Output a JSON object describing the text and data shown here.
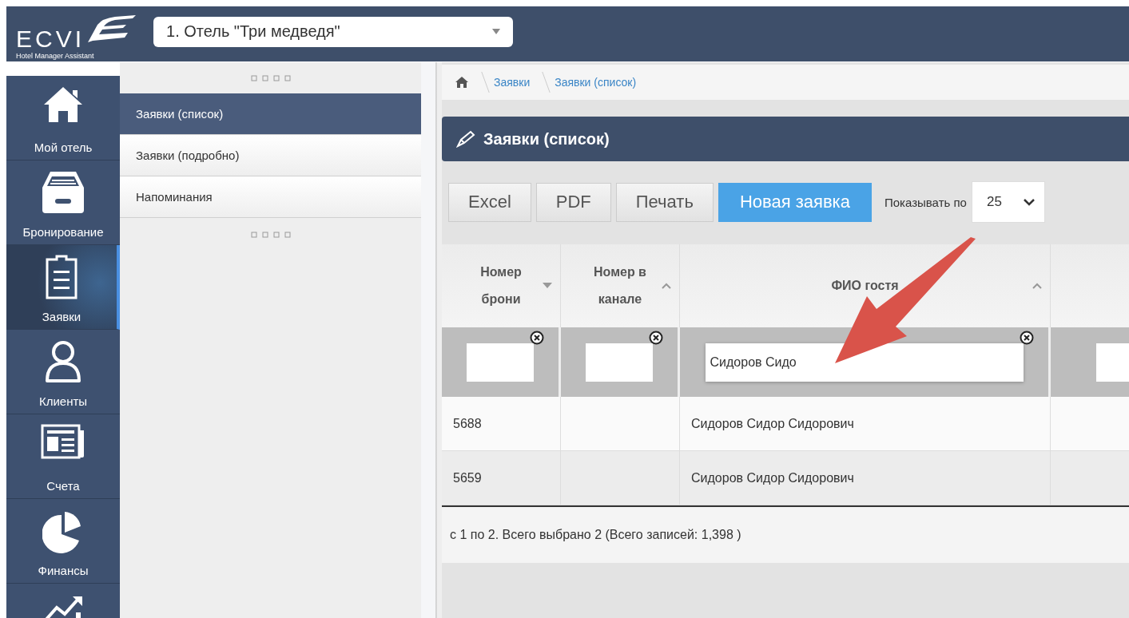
{
  "header": {
    "logo": {
      "wordmark": "ECVI",
      "tagline": "Hotel Manager Assistant"
    },
    "hotel_select": {
      "value": "1. Отель \"Три медведя\""
    }
  },
  "sidebar": {
    "items": [
      {
        "label": "Мой отель",
        "selected": false
      },
      {
        "label": "Бронирование",
        "selected": false
      },
      {
        "label": "Заявки",
        "selected": true
      },
      {
        "label": "Клиенты",
        "selected": false
      },
      {
        "label": "Счета",
        "selected": false
      },
      {
        "label": "Финансы",
        "selected": false
      },
      {
        "selected": false
      }
    ]
  },
  "submenu": {
    "items": [
      {
        "label": "Заявки (список)",
        "selected": true
      },
      {
        "label": "Заявки (подробно)",
        "selected": false
      },
      {
        "label": "Напоминания",
        "selected": false
      }
    ]
  },
  "breadcrumb": [
    "Заявки",
    "Заявки (список)"
  ],
  "panel": {
    "title": "Заявки (список)",
    "toolbar": {
      "buttons": [
        {
          "label": "Excel",
          "kind": "default"
        },
        {
          "label": "PDF",
          "kind": "default"
        },
        {
          "label": "Печать",
          "kind": "default"
        },
        {
          "label": "Новая заявка",
          "kind": "primary"
        }
      ],
      "page_size": {
        "label": "Показывать по",
        "value": "25"
      }
    },
    "table": {
      "columns": [
        {
          "label": "Номер брони",
          "sorted": true
        },
        {
          "label": "Номер в канале",
          "sorted": false
        },
        {
          "label": "ФИО гостя",
          "sorted": false
        },
        {}
      ],
      "filters": [
        {
          "clearable": true
        },
        {
          "clearable": true
        },
        {
          "value": "Сидоров Сидо",
          "clearable": true
        },
        {
          "clearable": false
        }
      ],
      "rows": [
        [
          "5688",
          "",
          "Сидоров Сидор Сидорович",
          ""
        ],
        [
          "5659",
          "",
          "Сидоров Сидор Сидорович",
          ""
        ]
      ]
    },
    "summary": "с 1 по 2. Всего выбрано 2 (Всего записей: 1,398 )"
  }
}
